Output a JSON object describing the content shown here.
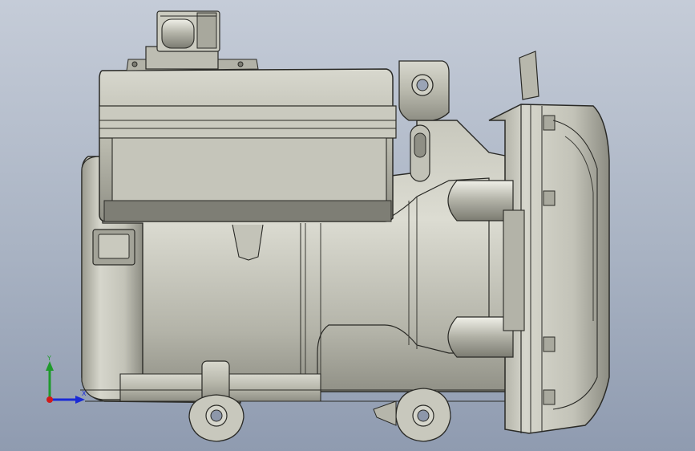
{
  "viewport": {
    "background_top": "#c5ccd8",
    "background_bottom": "#8f9bb0",
    "model_name": "",
    "model_icon": "electric-compressor-3d-model"
  },
  "triad": {
    "y_label": "Y",
    "x_label": "X",
    "x_color": "#1a2ad6",
    "y_color": "#1f9a2c",
    "origin_color": "#d11a1a"
  }
}
